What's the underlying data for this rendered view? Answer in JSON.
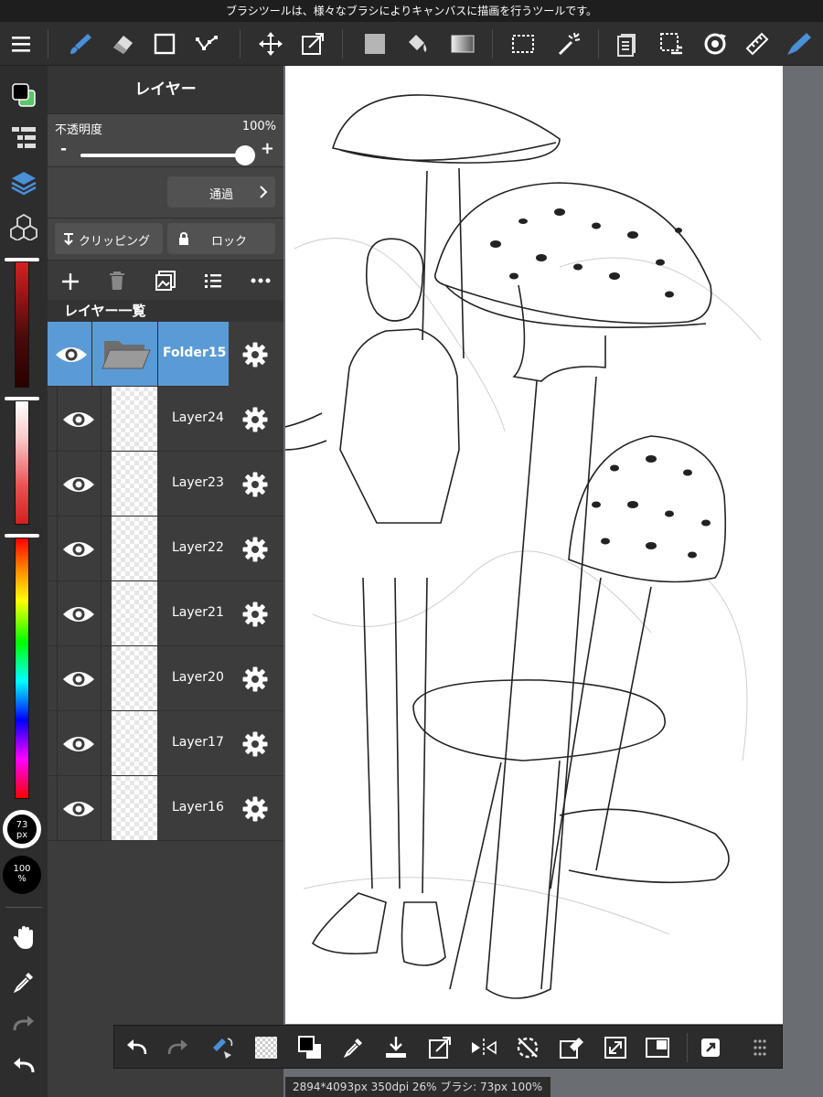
{
  "tipbar": {
    "text": "ブラシツールは、様々なブラシによりキャンバスに描画を行うツールです。"
  },
  "toolbar": {
    "icons": [
      "menu-icon",
      "brush-icon",
      "eraser-icon",
      "shape-icon",
      "dot-line-icon",
      "move-icon",
      "transform-icon",
      "fill-color-icon",
      "bucket-icon",
      "gradient-icon",
      "select-rect-icon",
      "magic-wand-icon",
      "layer-paper-icon",
      "select-extra-icon",
      "rotate-icon",
      "ruler-icon",
      "pen-icon"
    ]
  },
  "left": {
    "brush_size": "73",
    "brush_size_unit": "px",
    "brush_opacity": "100",
    "brush_opacity_unit": "%"
  },
  "panel": {
    "title": "レイヤー",
    "opacity_label": "不透明度",
    "opacity_value": "100%",
    "minus": "-",
    "plus": "+",
    "blend_mode": "通過",
    "clipping": "クリッピング",
    "lock": "ロック",
    "list_title": "レイヤー一覧",
    "opacity_fraction": 1.0
  },
  "layers": [
    {
      "name": "Folder15",
      "type": "folder",
      "selected": true
    },
    {
      "name": "Layer24",
      "type": "layer"
    },
    {
      "name": "Layer23",
      "type": "layer"
    },
    {
      "name": "Layer22",
      "type": "layer"
    },
    {
      "name": "Layer21",
      "type": "layer"
    },
    {
      "name": "Layer20",
      "type": "layer"
    },
    {
      "name": "Layer17",
      "type": "layer"
    },
    {
      "name": "Layer16",
      "type": "layer"
    }
  ],
  "status": {
    "text": "2894*4093px 350dpi 26% ブラシ: 73px 100%"
  },
  "colors": {
    "accent": "#4a90d9",
    "selected_row": "#5b9bd5"
  }
}
